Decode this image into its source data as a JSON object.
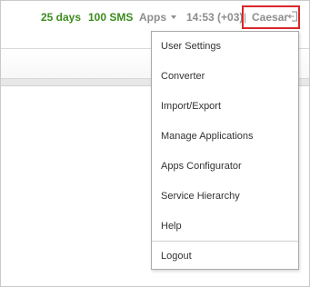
{
  "topbar": {
    "days": "25 days",
    "sms": "100 SMS",
    "apps_label": "Apps",
    "time": "14:53 (+03)",
    "separator": "|",
    "user": "Caesar"
  },
  "menu": {
    "items": [
      "User Settings",
      "Converter",
      "Import/Export",
      "Manage Applications",
      "Apps Configurator",
      "Service Hierarchy",
      "Help"
    ],
    "logout": "Logout"
  },
  "colors": {
    "green": "#3c8b1e",
    "grey": "#8d8d8d",
    "highlight": "#d9262b"
  },
  "icons": {
    "apps_caret": "caret-down-icon",
    "logout": "logout-icon"
  }
}
